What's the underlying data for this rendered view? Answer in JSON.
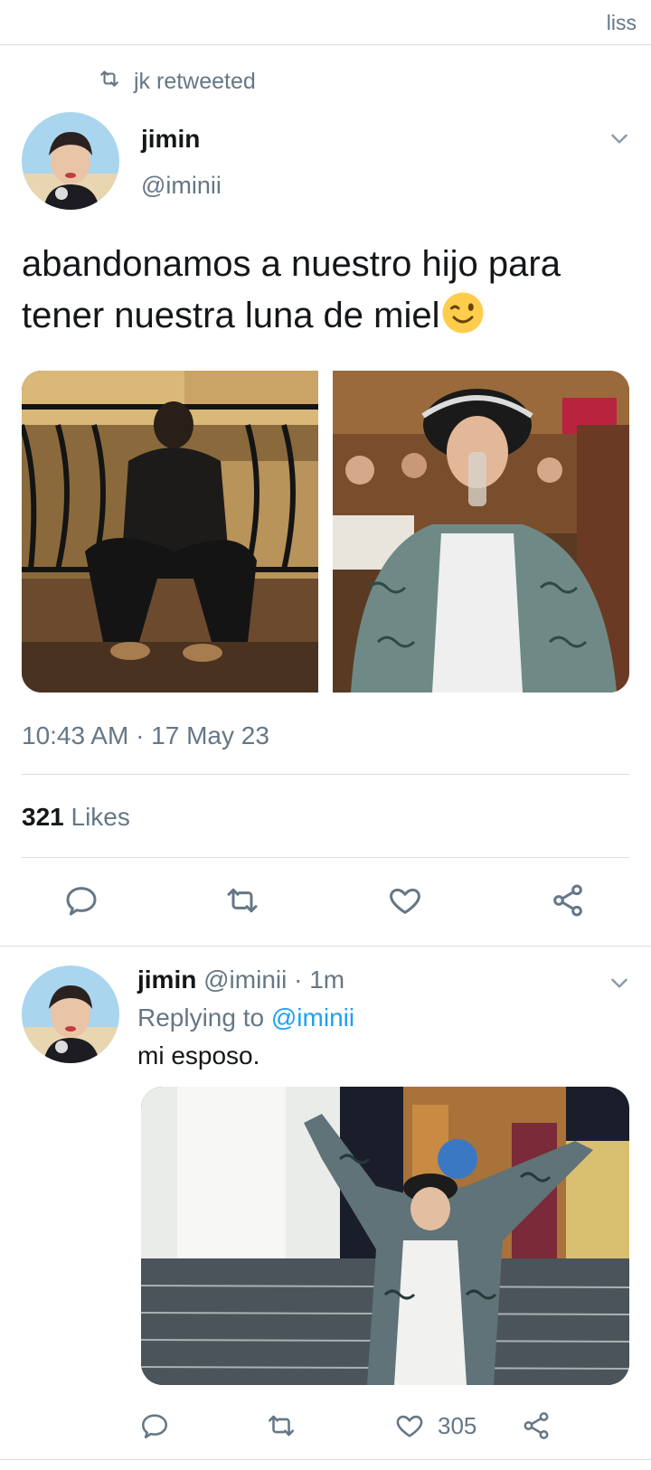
{
  "topbar": {
    "corner_text": "liss"
  },
  "retweet": {
    "text": "jk retweeted"
  },
  "main_tweet": {
    "author_name": "jimin",
    "author_handle": "@iminii",
    "text": "abandonamos a nuestro hijo para tener nuestra luna de miel",
    "emoji": "winking-face",
    "timestamp": "10:43 AM · 17 May 23",
    "likes_count": "321",
    "likes_label": "Likes"
  },
  "reply_tweet": {
    "author_name": "jimin",
    "author_handle": "@iminii",
    "time_sep": "·",
    "time": "1m",
    "replying_prefix": "Replying to",
    "replying_handle": "@iminii",
    "text": "mi esposo.",
    "like_count": "305"
  },
  "icons": {
    "reply": "reply-icon",
    "retweet": "retweet-icon",
    "like": "heart-icon",
    "share": "share-icon",
    "menu": "chevron-down-icon"
  },
  "colors": {
    "link": "#1da1f2",
    "muted": "#657786",
    "text": "#14171a",
    "divider": "#dadde0"
  }
}
